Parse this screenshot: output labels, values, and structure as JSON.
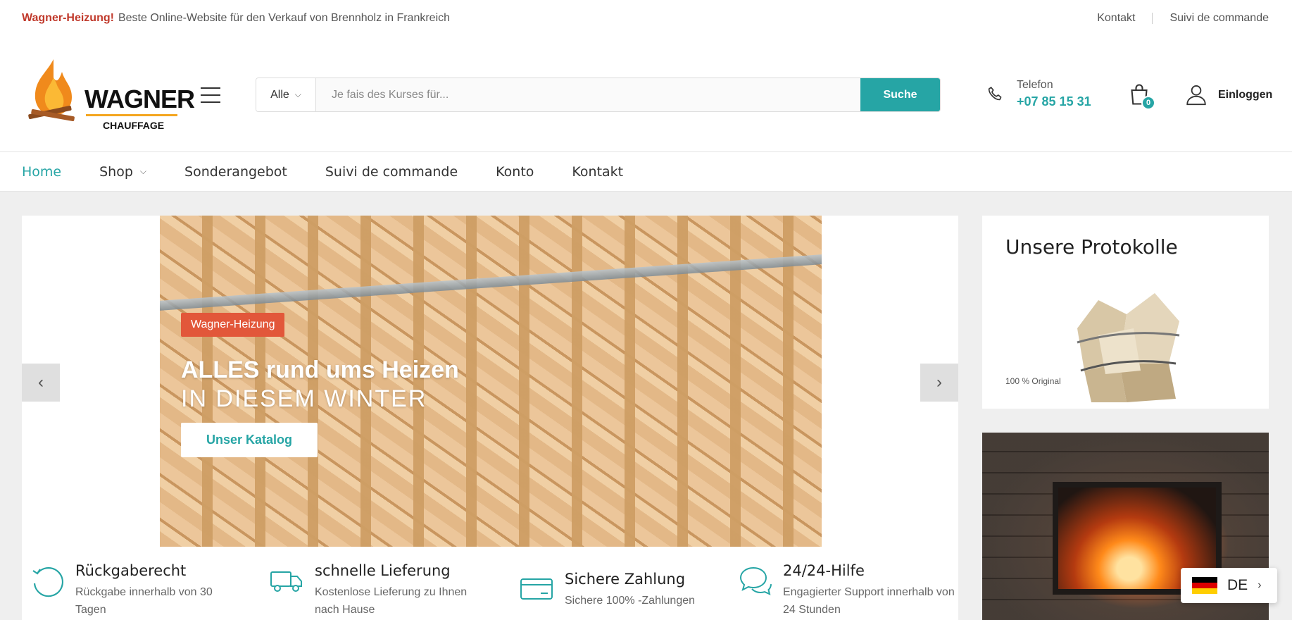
{
  "topbar": {
    "brand": "Wagner-Heizung!",
    "tagline": "Beste Online-Website für den Verkauf von Brennholz in Frankreich",
    "links": [
      "Kontakt",
      "Suivi de commande"
    ]
  },
  "header": {
    "logo_word": "WAGNER",
    "logo_sub": "CHAUFFAGE",
    "search": {
      "category": "Alle",
      "placeholder": "Je fais des Kurses für...",
      "button": "Suche"
    },
    "phone_label": "Telefon",
    "phone_number": "+07 85 15 31",
    "cart_count": "0",
    "login": "Einloggen"
  },
  "nav": {
    "items": [
      "Home",
      "Shop",
      "Sonderangebot",
      "Suivi de commande",
      "Konto",
      "Kontakt"
    ],
    "active": "Home"
  },
  "slider": {
    "tag": "Wagner-Heizung",
    "headline": "ALLES rund ums Heizen",
    "subheadline": "IN DIESEM WINTER",
    "cta": "Unser Katalog"
  },
  "features": [
    {
      "icon": "return-icon",
      "title": "Rückgaberecht",
      "desc": "Rückgabe innerhalb von 30 Tagen"
    },
    {
      "icon": "truck-icon",
      "title": "schnelle Lieferung",
      "desc": "Kostenlose Lieferung zu Ihnen nach Hause"
    },
    {
      "icon": "card-icon",
      "title": "Sichere Zahlung",
      "desc": "Sichere 100% -Zahlungen"
    },
    {
      "icon": "chat-icon",
      "title": "24/24-Hilfe",
      "desc": "Engagierter Support innerhalb von 24 Stunden"
    }
  ],
  "sidebar": {
    "promo_title": "Unsere Protokolle",
    "promo_note": "100 % Original"
  },
  "language": {
    "code": "DE"
  },
  "colors": {
    "accent": "#26a5a5",
    "brand_red": "#c0392b",
    "tag_orange": "#e2573a"
  }
}
